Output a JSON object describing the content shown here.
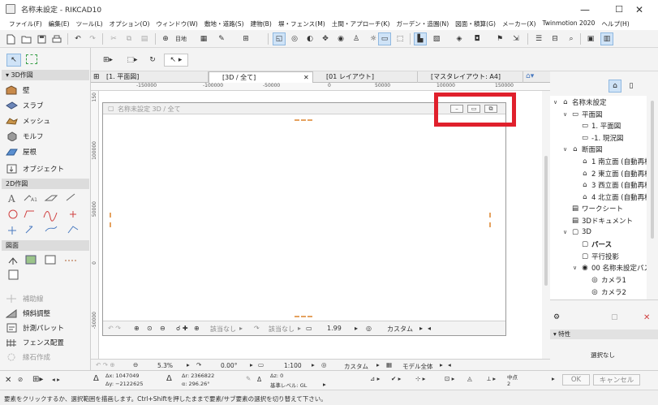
{
  "window": {
    "title": "名称未設定 - RIKCAD10",
    "controls": {
      "minimize": "—",
      "maximize": "☐",
      "close": "✕"
    }
  },
  "menu": [
    "ファイル(F)",
    "編集(E)",
    "ツール(L)",
    "オプション(O)",
    "ウィンドウ(W)",
    "敷地・道路(S)",
    "建物(B)",
    "塀・フェンス(M)",
    "土間・アプローチ(K)",
    "ガーデン・造園(N)",
    "図面・積算(G)",
    "メーカー(X)",
    "Twinmotion 2020",
    "ヘルプ(H)"
  ],
  "toolbar": {
    "story_label": "目地"
  },
  "toolbox": {
    "section_3d": "▾ 3D作図",
    "tools_3d": [
      "壁",
      "スラブ",
      "メッシュ",
      "モルフ",
      "屋根",
      "オブジェクト"
    ],
    "section_2d": "2D作図",
    "section_drawing": "図面",
    "bottom_tools": [
      "補助線",
      "傾斜調整",
      "計測パレット",
      "フェンス配置",
      "縁石作成"
    ]
  },
  "view_tabs": [
    {
      "label": "[1. 平面図]"
    },
    {
      "label": "[3D / 全て]",
      "active": true,
      "close": "✕"
    },
    {
      "label": "[01 レイアウト]"
    },
    {
      "label": "[マスタレイアウト: A4]"
    }
  ],
  "ruler": {
    "h": [
      "-150000",
      "-100000",
      "-50000",
      "0",
      "50000",
      "100000",
      "150000"
    ],
    "v": [
      "150",
      "100000",
      "50000",
      "0",
      "-50000"
    ]
  },
  "window3d": {
    "title": "名称未設定 3D / 全て",
    "footer": {
      "layer1": "該当なし",
      "layer2": "該当なし",
      "scale": "1.99",
      "custom": "カスタム"
    }
  },
  "viewstrip": {
    "zoom": "5.3%",
    "angle": "0.00°",
    "scale": "1:100",
    "custom": "カスタム",
    "model": "モデル全体"
  },
  "infobox": {
    "dx": "Δx: 1047049",
    "dy": "Δy: −2122625",
    "da": "Δr: 2366822",
    "angle": "α: 296.26°",
    "dz": "Δz: 0",
    "ref": "基準レベル: GL",
    "midpoint": "中点",
    "mid_n": "2",
    "ok": "OK",
    "cancel": "キャンセル"
  },
  "status": "要素をクリックするか、選択範囲を描画します。Ctrl+Shiftを押したままで要素/サブ要素の選択を切り替えて下さい。",
  "navigator": {
    "items": [
      {
        "label": "名称未設定",
        "depth": 0,
        "arrow": "∨"
      },
      {
        "label": "平面図",
        "depth": 1,
        "arrow": "∨"
      },
      {
        "label": "1. 平面図",
        "depth": 2,
        "arrow": ""
      },
      {
        "label": "-1. 現況図",
        "depth": 2,
        "arrow": ""
      },
      {
        "label": "断面図",
        "depth": 1,
        "arrow": "∨"
      },
      {
        "label": "1 南立面 (自動再構",
        "depth": 2,
        "arrow": ""
      },
      {
        "label": "2 東立面 (自動再構",
        "depth": 2,
        "arrow": ""
      },
      {
        "label": "3 西立面 (自動再構",
        "depth": 2,
        "arrow": ""
      },
      {
        "label": "4 北立面 (自動再構",
        "depth": 2,
        "arrow": ""
      },
      {
        "label": "ワークシート",
        "depth": 1,
        "arrow": ""
      },
      {
        "label": "3Dドキュメント",
        "depth": 1,
        "arrow": ""
      },
      {
        "label": "3D",
        "depth": 1,
        "arrow": "∨"
      },
      {
        "label": "パース",
        "depth": 2,
        "arrow": ""
      },
      {
        "label": "平行投影",
        "depth": 2,
        "arrow": ""
      },
      {
        "label": "00 名称未設定パス",
        "depth": 2,
        "arrow": "∨"
      },
      {
        "label": "カメラ1",
        "depth": 3,
        "arrow": ""
      },
      {
        "label": "カメラ2",
        "depth": 3,
        "arrow": ""
      }
    ],
    "props_header": "▾ 特性",
    "no_selection": "選択なし"
  }
}
